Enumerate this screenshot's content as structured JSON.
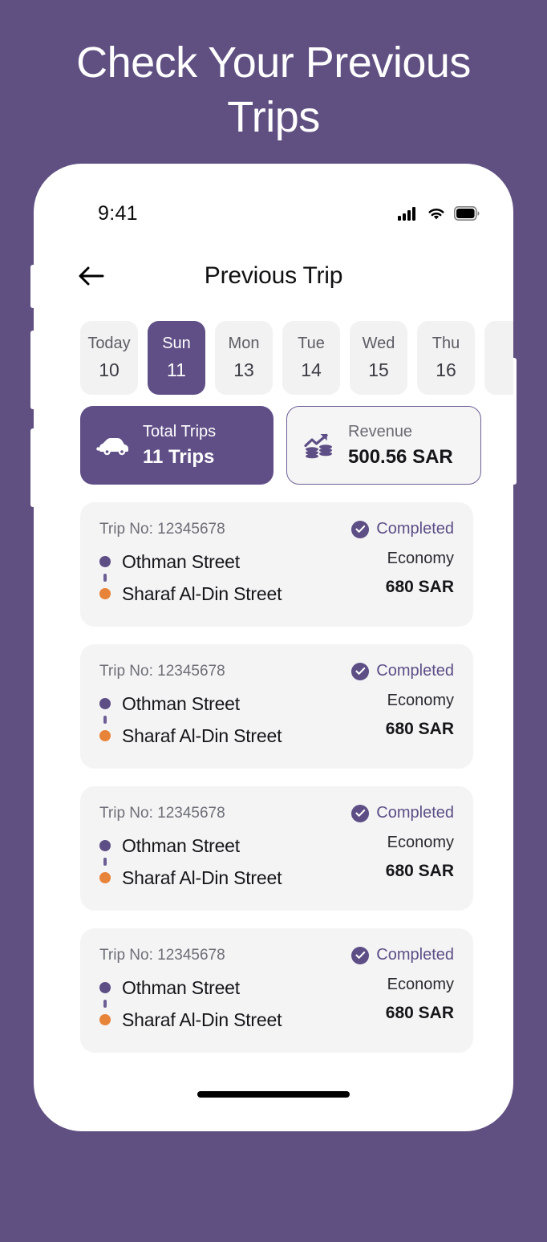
{
  "page": {
    "heading": "Check Your Previous Trips",
    "background_color": "#605082",
    "accent_color": "#604F86",
    "destination_color": "#E8833A"
  },
  "status_bar": {
    "time": "9:41",
    "signal_icon": "cellular-signal-icon",
    "wifi_icon": "wifi-icon",
    "battery_icon": "battery-full-icon"
  },
  "nav": {
    "back_icon": "arrow-left-icon",
    "title": "Previous Trip"
  },
  "date_strip": {
    "items": [
      {
        "dow": "Today",
        "day": "10",
        "selected": false
      },
      {
        "dow": "Sun",
        "day": "11",
        "selected": true
      },
      {
        "dow": "Mon",
        "day": "13",
        "selected": false
      },
      {
        "dow": "Tue",
        "day": "14",
        "selected": false
      },
      {
        "dow": "Wed",
        "day": "15",
        "selected": false
      },
      {
        "dow": "Thu",
        "day": "16",
        "selected": false
      },
      {
        "dow": "",
        "day": "",
        "selected": false
      }
    ]
  },
  "stats": {
    "total_trips": {
      "icon": "car-icon",
      "label": "Total Trips",
      "value": "11 Trips"
    },
    "revenue": {
      "icon": "revenue-growth-icon",
      "label": "Revenue",
      "value": "500.56 SAR"
    }
  },
  "trips": [
    {
      "trip_no": "Trip No: 12345678",
      "status": "Completed",
      "origin": "Othman Street",
      "destination": "Sharaf Al-Din Street",
      "car_class": "Economy",
      "fare": "680 SAR"
    },
    {
      "trip_no": "Trip No: 12345678",
      "status": "Completed",
      "origin": "Othman Street",
      "destination": "Sharaf Al-Din Street",
      "car_class": "Economy",
      "fare": "680 SAR"
    },
    {
      "trip_no": "Trip No: 12345678",
      "status": "Completed",
      "origin": "Othman Street",
      "destination": "Sharaf Al-Din Street",
      "car_class": "Economy",
      "fare": "680 SAR"
    },
    {
      "trip_no": "Trip No: 12345678",
      "status": "Completed",
      "origin": "Othman Street",
      "destination": "Sharaf Al-Din Street",
      "car_class": "Economy",
      "fare": "680 SAR"
    }
  ]
}
